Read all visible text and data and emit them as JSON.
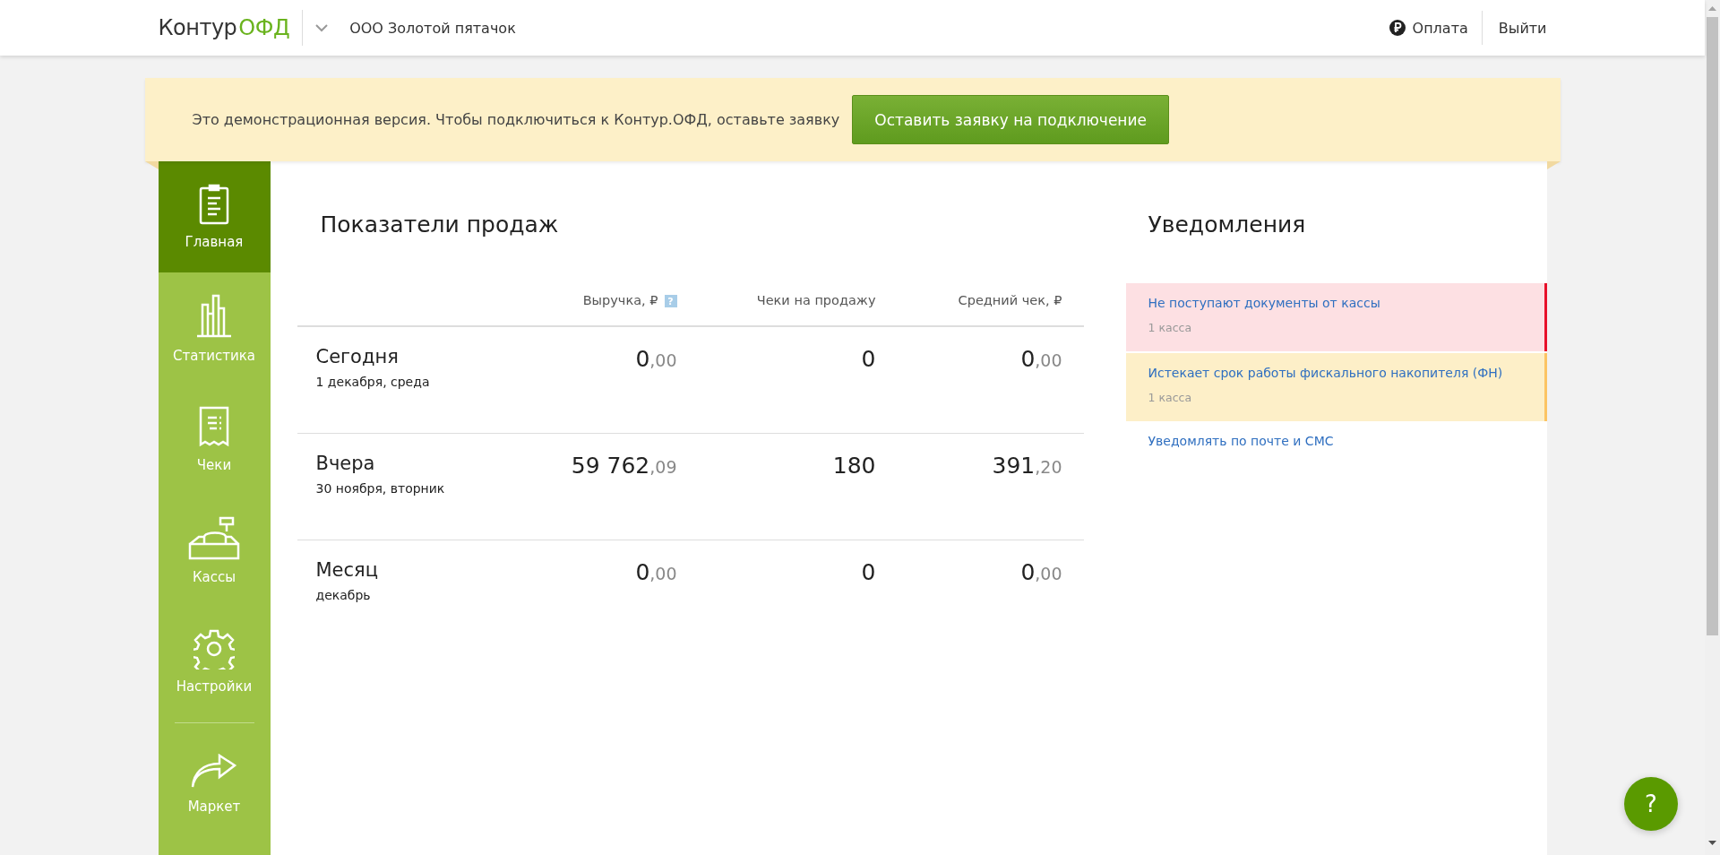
{
  "header": {
    "logo": {
      "brand": "Контур",
      "product": "ОФД"
    },
    "organization": "ООО Золотой пятачок",
    "payment": "Оплата",
    "logout": "Выйти"
  },
  "banner": {
    "text": "Это демонстрационная версия. Чтобы подключиться к Контур.ОФД, оставьте заявку",
    "button": "Оставить заявку на подключение"
  },
  "sidebar": {
    "items": [
      {
        "label": "Главная",
        "kind": "home",
        "selected": true
      },
      {
        "label": "Статистика",
        "kind": "statistics",
        "selected": false
      },
      {
        "label": "Чеки",
        "kind": "receipts",
        "selected": false
      },
      {
        "label": "Кассы",
        "kind": "registers",
        "selected": false
      },
      {
        "label": "Настройки",
        "kind": "settings",
        "selected": false
      }
    ],
    "bottom_items": [
      {
        "label": "Маркет",
        "kind": "market",
        "selected": false
      }
    ]
  },
  "sales": {
    "title": "Показатели продаж",
    "columns": [
      {
        "label": "Выручка, ₽",
        "hint": "?"
      },
      {
        "label": "Чеки на продажу"
      },
      {
        "label": "Средний чек, ₽"
      }
    ],
    "rows": [
      {
        "period": "Сегодня",
        "date": "1 декабря, среда",
        "revenue": {
          "whole": "0",
          "fraction": ",00"
        },
        "receipts": "0",
        "average": {
          "whole": "0",
          "fraction": ",00"
        }
      },
      {
        "period": "Вчера",
        "date": "30 ноября, вторник",
        "revenue": {
          "whole": "59 762",
          "fraction": ",09"
        },
        "receipts": "180",
        "average": {
          "whole": "391",
          "fraction": ",20"
        }
      },
      {
        "period": "Месяц",
        "date": "декабрь",
        "revenue": {
          "whole": "0",
          "fraction": ",00"
        },
        "receipts": "0",
        "average": {
          "whole": "0",
          "fraction": ",00"
        }
      }
    ]
  },
  "notifications": {
    "title": "Уведомления",
    "items": [
      {
        "kind": "error",
        "title": "Не поступают документы от кассы",
        "detail": "1 касса"
      },
      {
        "kind": "warning",
        "title": "Истекает срок работы фискального накопителя (ФН)",
        "detail": "1 касса"
      }
    ],
    "settings_link": "Уведомлять по почте и СМС"
  },
  "help_button": "?"
}
